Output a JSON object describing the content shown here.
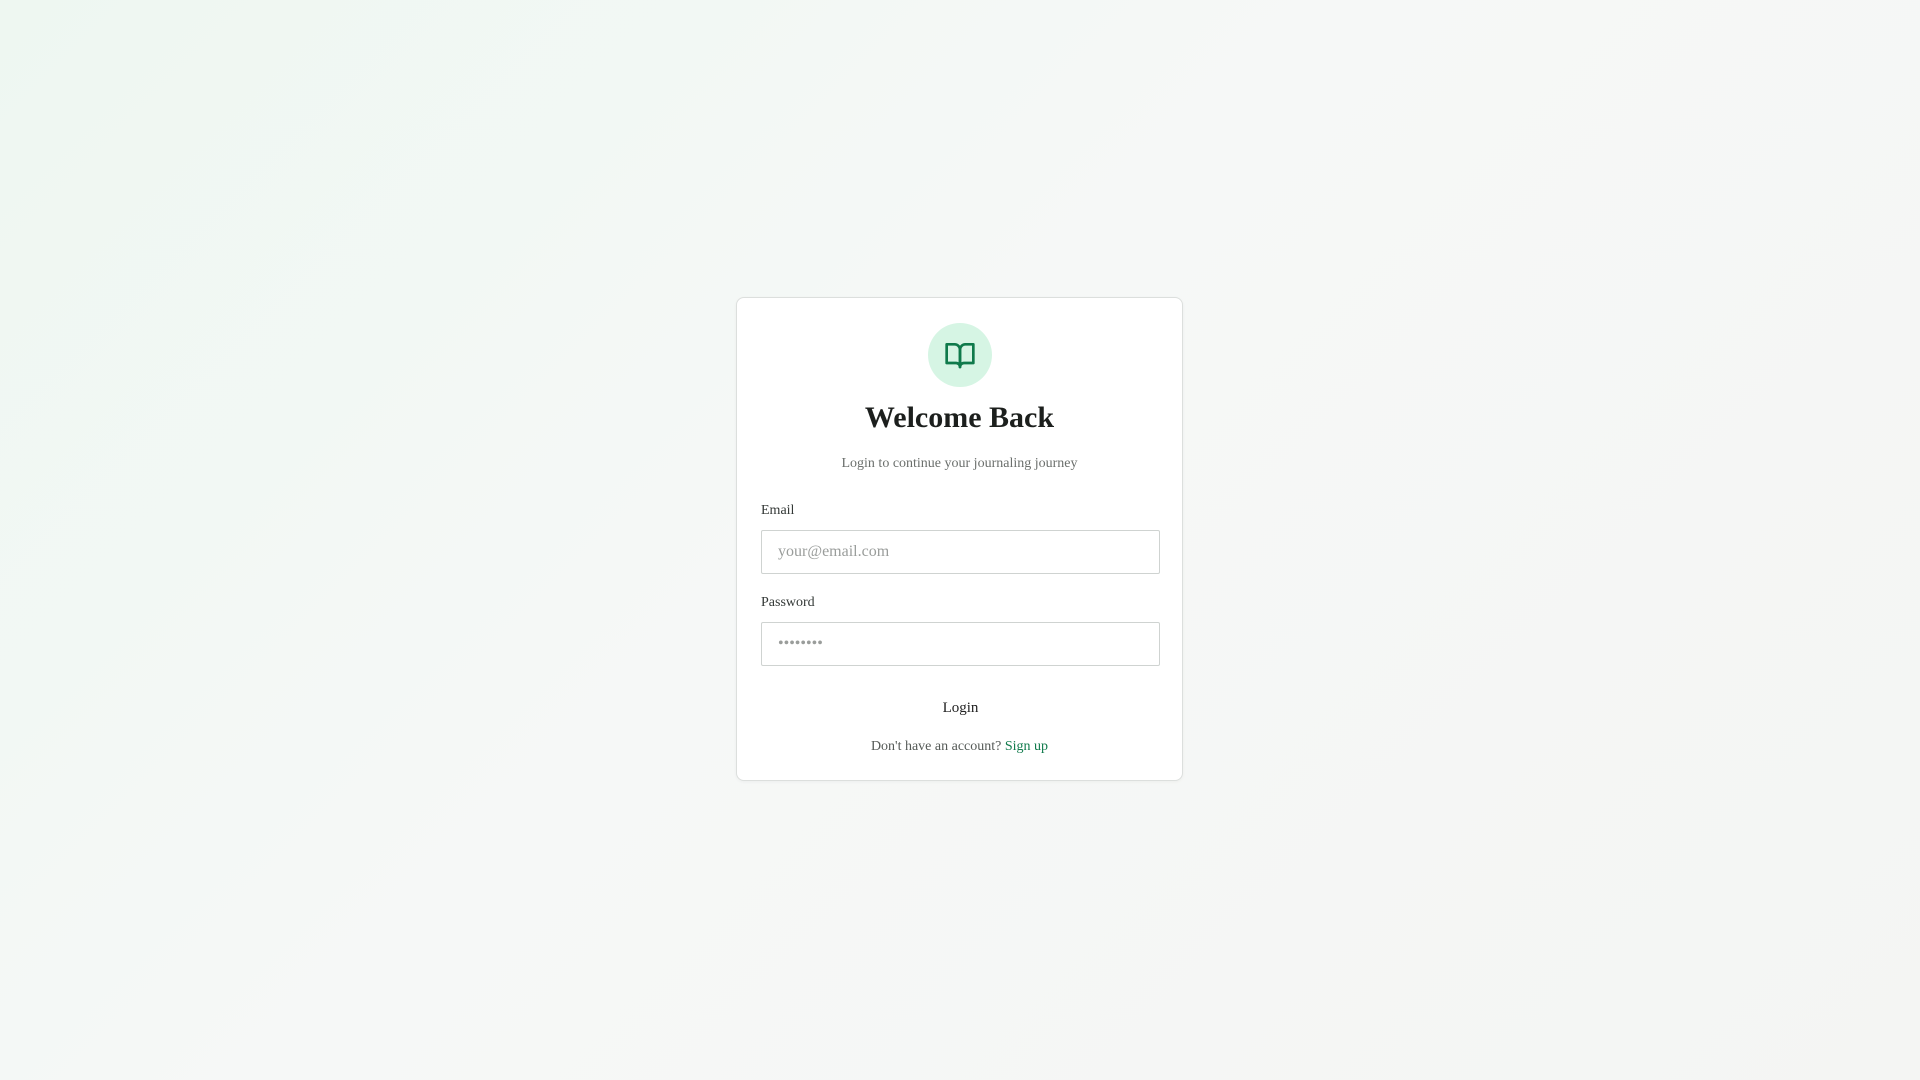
{
  "login": {
    "logo_icon": "open-book-icon",
    "title": "Welcome Back",
    "subtitle": "Login to continue your journaling journey",
    "email_label": "Email",
    "email_placeholder": "your@email.com",
    "email_value": "",
    "password_label": "Password",
    "password_placeholder": "••••••••",
    "password_value": "",
    "login_button": "Login",
    "signup_prompt": "Don't have an account?",
    "signup_link": "Sign up"
  },
  "colors": {
    "accent": "#0f7a4b",
    "logo_background": "#d6f5e4"
  }
}
